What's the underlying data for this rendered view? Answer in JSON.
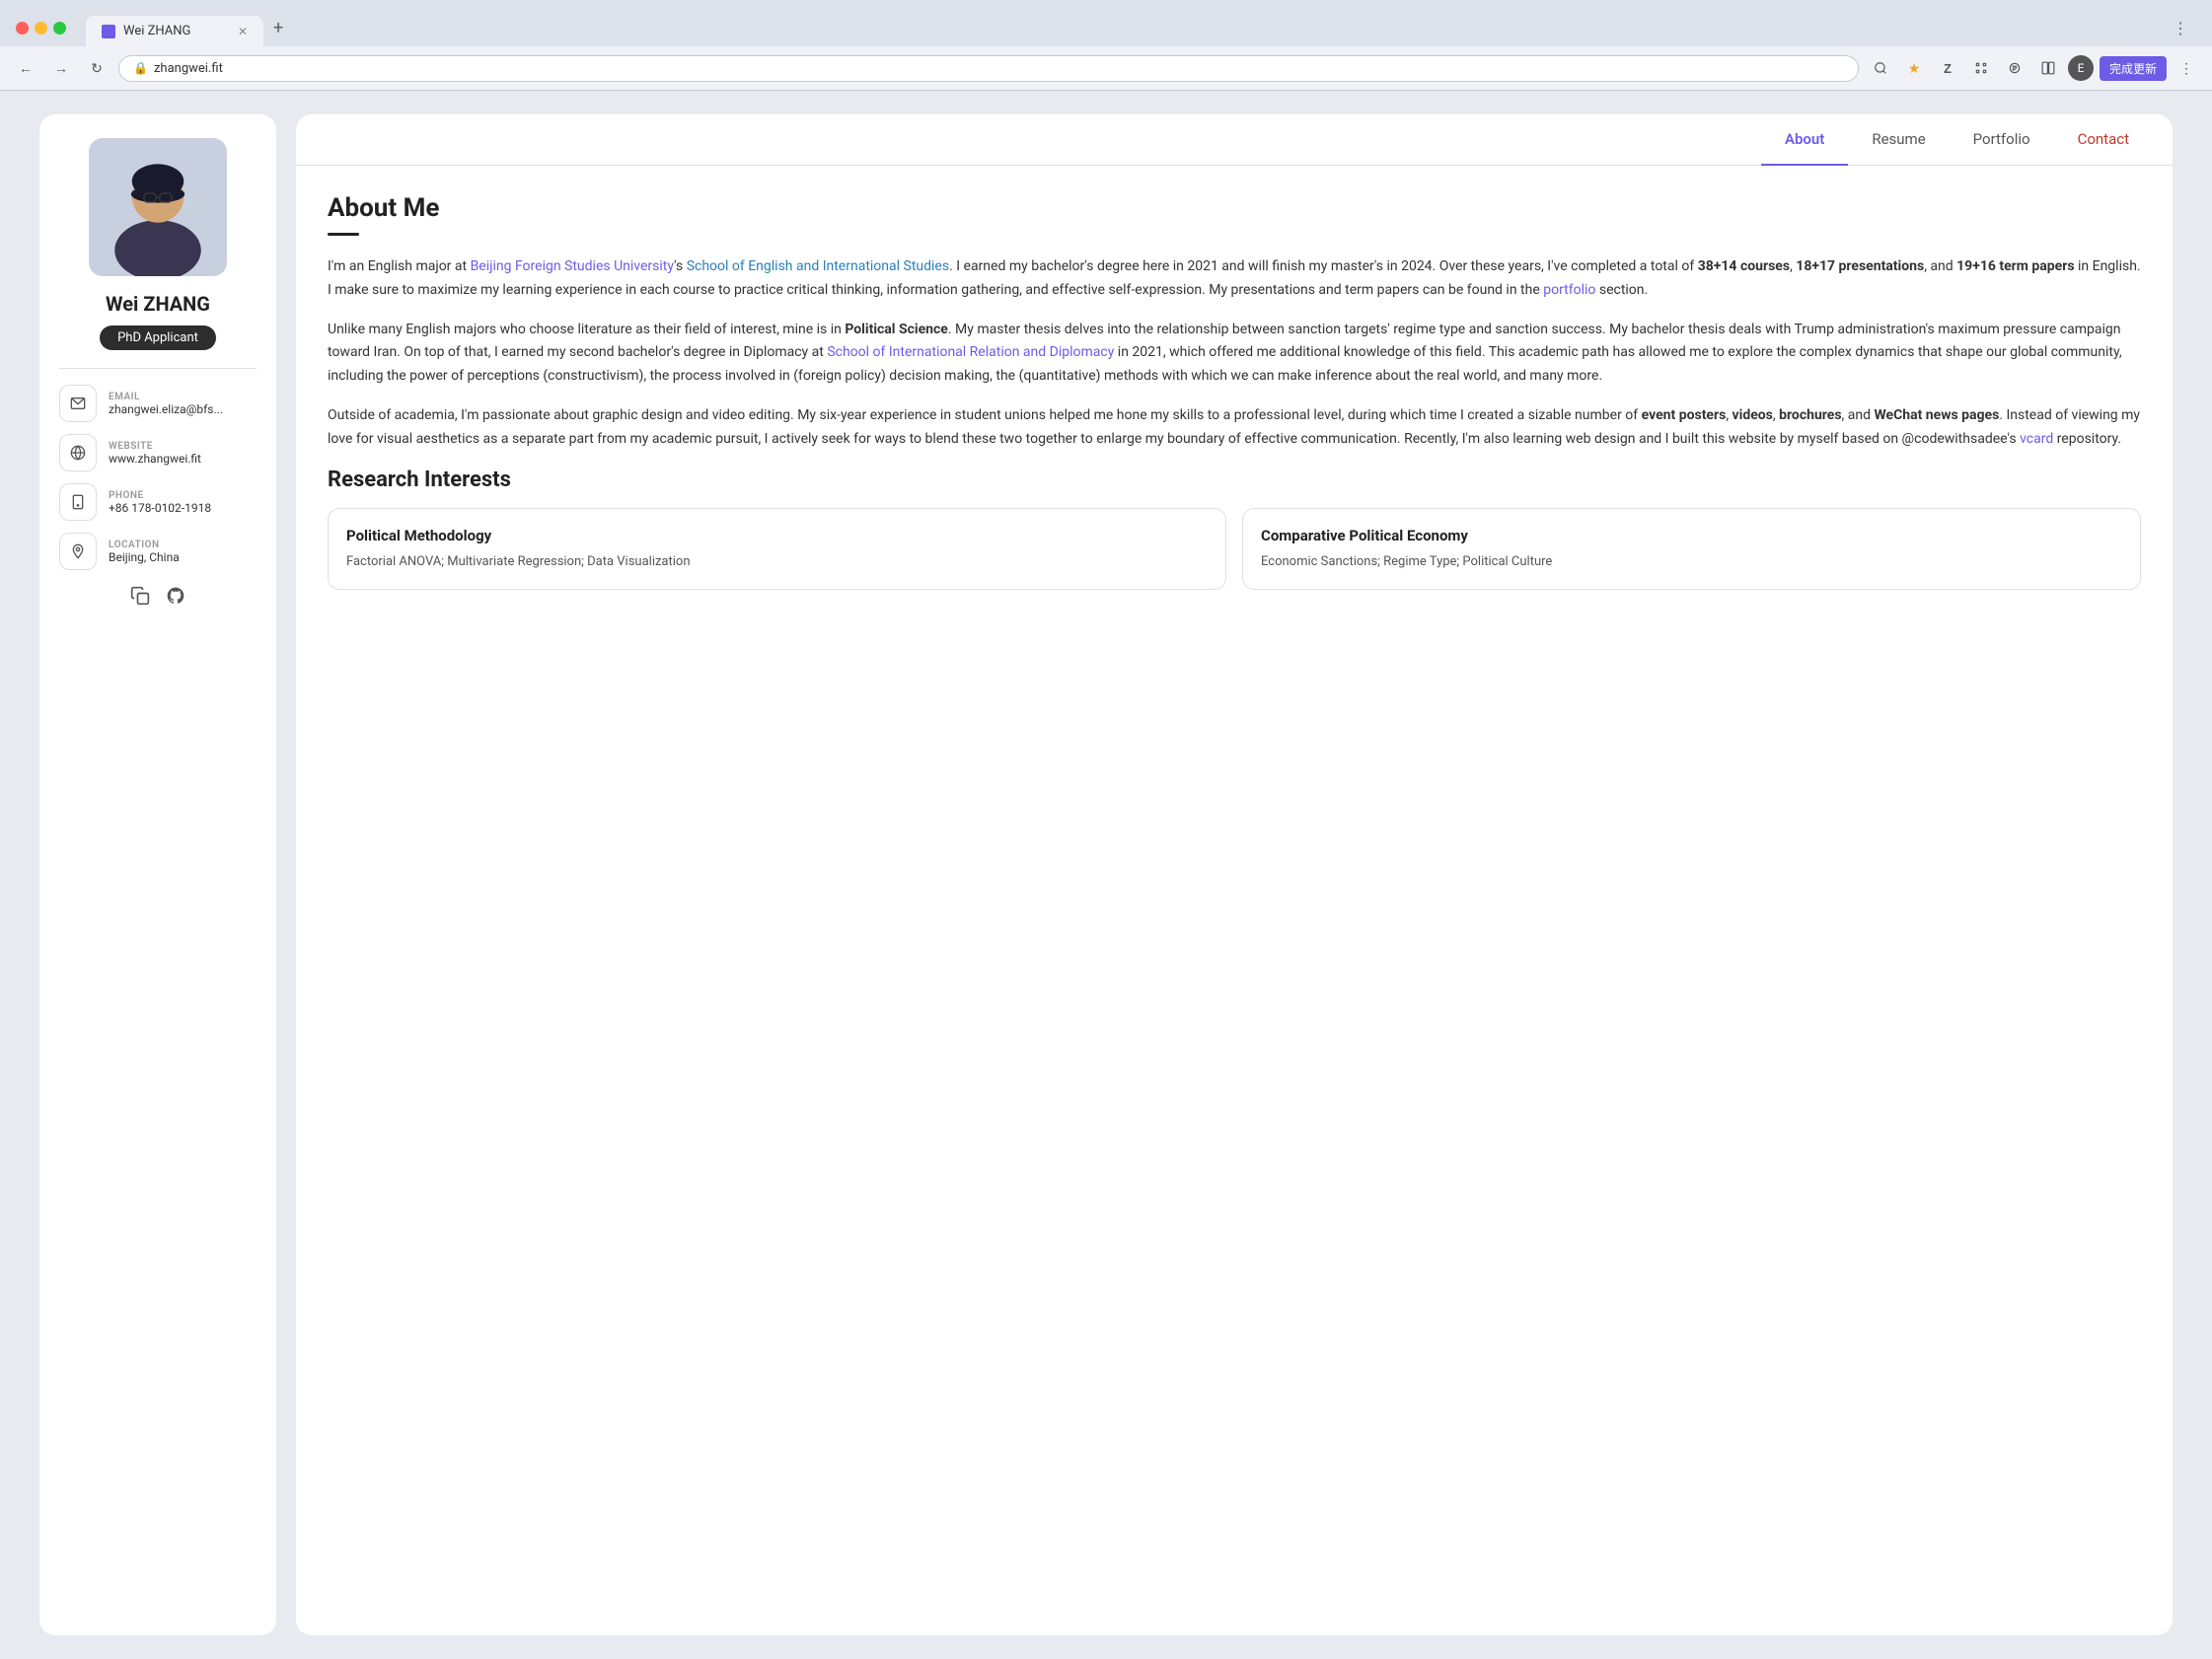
{
  "browser": {
    "tab_title": "Wei ZHANG",
    "tab_close": "✕",
    "tab_new": "+",
    "more_label": "⋮",
    "address": "zhangwei.fit",
    "back_icon": "←",
    "forward_icon": "→",
    "refresh_icon": "↻",
    "lock_icon": "🔒",
    "update_label": "完成更新",
    "avatar_label": "E"
  },
  "sidebar": {
    "name": "Wei ZHANG",
    "badge": "PhD Applicant",
    "contacts": [
      {
        "label": "EMAIL",
        "value": "zhangwei.eliza@bfs...",
        "icon": "email"
      },
      {
        "label": "WEBSITE",
        "value": "www.zhangwei.fit",
        "icon": "globe"
      },
      {
        "label": "PHONE",
        "value": "+86 178-0102-1918",
        "icon": "phone"
      },
      {
        "label": "LOCATION",
        "value": "Beijing, China",
        "icon": "location"
      }
    ],
    "social_copy_icon": "copy",
    "social_github_icon": "github"
  },
  "nav": {
    "tabs": [
      {
        "label": "About",
        "active": true
      },
      {
        "label": "Resume",
        "active": false
      },
      {
        "label": "Portfolio",
        "active": false
      },
      {
        "label": "Contact",
        "active": false
      }
    ]
  },
  "about": {
    "section_title": "About Me",
    "paragraphs": [
      {
        "id": "p1",
        "text_parts": [
          {
            "type": "text",
            "content": "I'm an English major at "
          },
          {
            "type": "link",
            "content": "Beijing Foreign Studies University",
            "color": "purple"
          },
          {
            "type": "text",
            "content": "'s "
          },
          {
            "type": "link",
            "content": "School of English and International Studies",
            "color": "blue"
          },
          {
            "type": "text",
            "content": ". I earned my bachelor's degree here in 2021 and will finish my master's in 2024. Over these years, I've completed a total of "
          },
          {
            "type": "bold",
            "content": "38+14 courses"
          },
          {
            "type": "text",
            "content": ", "
          },
          {
            "type": "bold",
            "content": "18+17 presentations"
          },
          {
            "type": "text",
            "content": ", and "
          },
          {
            "type": "bold",
            "content": "19+16 term papers"
          },
          {
            "type": "text",
            "content": " in English. I make sure to maximize my learning experience in each course to practice critical thinking, information gathering, and effective self-expression. My presentations and term papers can be found in the "
          },
          {
            "type": "link",
            "content": "portfolio",
            "color": "purple"
          },
          {
            "type": "text",
            "content": " section."
          }
        ]
      },
      {
        "id": "p2",
        "text_parts": [
          {
            "type": "text",
            "content": "Unlike many English majors who choose literature as their field of interest, mine is in "
          },
          {
            "type": "bold",
            "content": "Political Science"
          },
          {
            "type": "text",
            "content": ". My master thesis delves into the relationship between sanction targets' regime type and sanction success. My bachelor thesis deals with Trump administration's maximum pressure campaign toward Iran. On top of that, I earned my second bachelor's degree in Diplomacy at "
          },
          {
            "type": "link",
            "content": "School of International Relation and Diplomacy",
            "color": "purple"
          },
          {
            "type": "text",
            "content": " in 2021, which offered me additional knowledge of this field. This academic path has allowed me to explore the complex dynamics that shape our global community, including the power of perceptions (constructivism), the process involved in (foreign policy) decision making, the (quantitative) methods with which we can make inference about the real world, and many more."
          }
        ]
      },
      {
        "id": "p3",
        "text_parts": [
          {
            "type": "text",
            "content": "Outside of academia, I'm passionate about graphic design and video editing. My six-year experience in student unions helped me hone my skills to a professional level, during which time I created a sizable number of "
          },
          {
            "type": "bold",
            "content": "event posters"
          },
          {
            "type": "text",
            "content": ", "
          },
          {
            "type": "bold",
            "content": "videos"
          },
          {
            "type": "text",
            "content": ", "
          },
          {
            "type": "bold",
            "content": "brochures"
          },
          {
            "type": "text",
            "content": ", and "
          },
          {
            "type": "bold",
            "content": "WeChat news pages"
          },
          {
            "type": "text",
            "content": ". Instead of viewing my love for visual aesthetics as a separate part from my academic pursuit, I actively seek for ways to blend these two together to enlarge my boundary of effective communication. Recently, I'm also learning web design and I built this website by myself based on @codewithsadee's "
          },
          {
            "type": "link",
            "content": "vcard",
            "color": "purple"
          },
          {
            "type": "text",
            "content": " repository."
          }
        ]
      }
    ],
    "research_title": "Research Interests",
    "research_cards": [
      {
        "title": "Political Methodology",
        "body": "Factorial ANOVA; Multivariate Regression; Data Visualization"
      },
      {
        "title": "Comparative Political Economy",
        "body": "Economic Sanctions; Regime Type; Political Culture"
      }
    ]
  }
}
